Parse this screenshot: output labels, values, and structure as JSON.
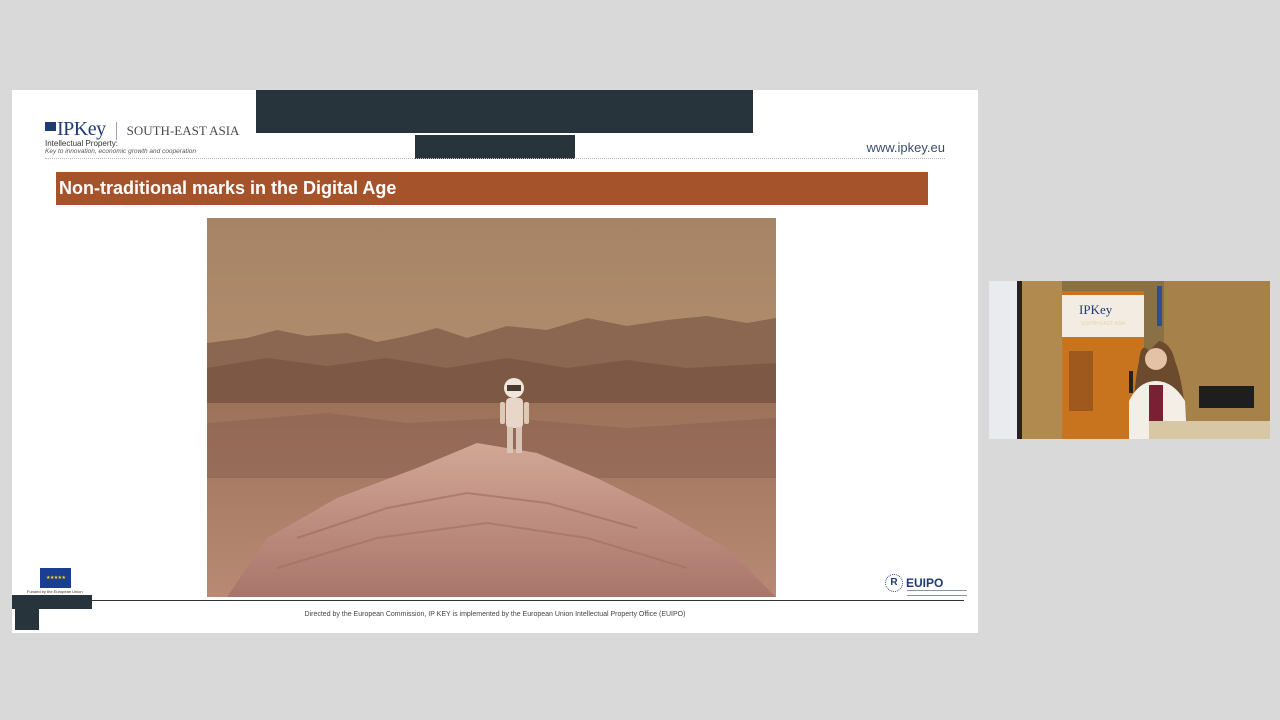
{
  "slide": {
    "logo": {
      "brand": "IPKey",
      "region": "SOUTH-EAST ASIA",
      "sub_line1": "Intellectual Property:",
      "sub_line2": "Key to innovation, economic growth and cooperation"
    },
    "url": "www.ipkey.eu",
    "title": "Non-traditional marks in the Digital Age",
    "image_icon": "astronaut-desert-photo",
    "eu_flag_stars": "★ ★ ★ ★ ★",
    "eu_caption": "Funded by the European Union",
    "euipo": {
      "r_letter": "R",
      "wordmark": "EUIPO"
    },
    "footer": "Directed by the European Commission, IP KEY is implemented by the European Union Intellectual Property Office (EUIPO)"
  },
  "speaker_video": {
    "banner_brand": "IPKey",
    "banner_region": "SOUTH-EAST ASIA"
  },
  "colors": {
    "title_bar": "#a5532b",
    "brand_blue": "#1f3b73",
    "redaction": "#27343b",
    "background": "#d9d9d9"
  }
}
